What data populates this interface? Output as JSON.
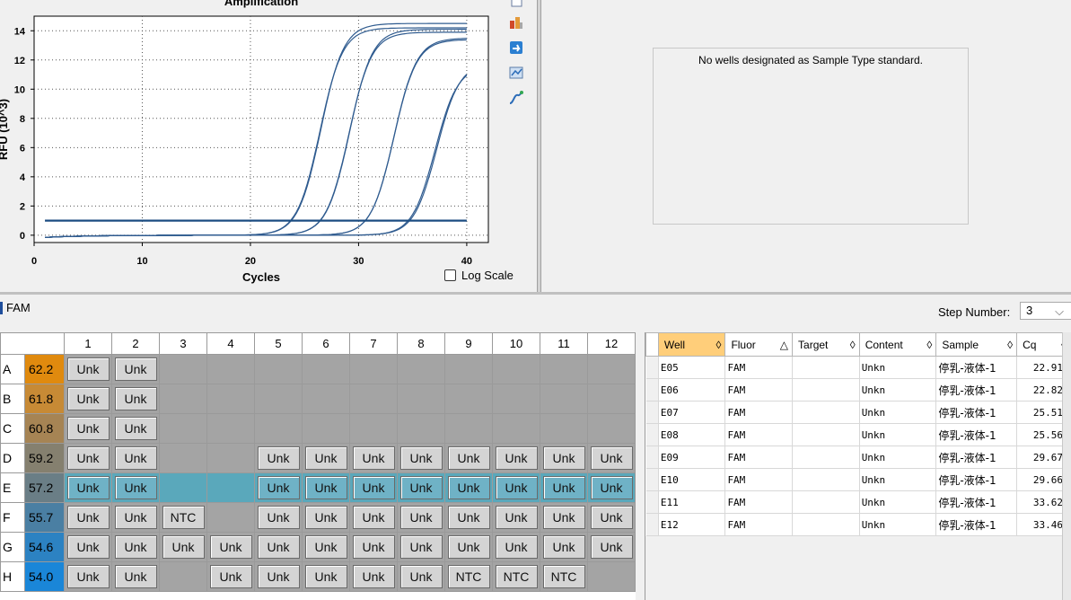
{
  "chart": {
    "title": "Amplification",
    "xlabel": "Cycles",
    "ylabel": "RFU (10^3)",
    "log_scale_label": "Log Scale"
  },
  "chart_data": {
    "type": "line",
    "title": "Amplification",
    "xlabel": "Cycles",
    "ylabel": "RFU (10^3)",
    "xlim": [
      0,
      42
    ],
    "ylim": [
      -0.5,
      15
    ],
    "x_ticks": [
      0,
      10,
      20,
      30,
      40
    ],
    "y_ticks": [
      0,
      2,
      4,
      6,
      8,
      10,
      12,
      14
    ],
    "threshold": 1.0,
    "grid": true,
    "series": [
      {
        "values_desc": "sigmoid",
        "cq": 22.91,
        "plateau": 14.5
      },
      {
        "values_desc": "sigmoid",
        "cq": 22.82,
        "plateau": 14.2
      },
      {
        "values_desc": "sigmoid",
        "cq": 25.51,
        "plateau": 13.9
      },
      {
        "values_desc": "sigmoid",
        "cq": 25.56,
        "plateau": 14.1
      },
      {
        "values_desc": "sigmoid",
        "cq": 29.67,
        "plateau": 13.5
      },
      {
        "values_desc": "sigmoid",
        "cq": 29.66,
        "plateau": 13.4
      },
      {
        "values_desc": "sigmoid",
        "cq": 33.62,
        "plateau": 11.8
      },
      {
        "values_desc": "sigmoid",
        "cq": 33.46,
        "plateau": 11.6
      }
    ],
    "color": "#2f5b8f"
  },
  "standard": {
    "message": "No wells designated as Sample Type standard."
  },
  "fluor": {
    "name": "FAM",
    "step_label": "Step Number:",
    "step_value": "3"
  },
  "plate": {
    "columns": [
      "1",
      "2",
      "3",
      "4",
      "5",
      "6",
      "7",
      "8",
      "9",
      "10",
      "11",
      "12"
    ],
    "rows": [
      {
        "label": "A",
        "temp": "62.2",
        "color": "#e08a0e",
        "wells": [
          "Unk",
          "Unk",
          "",
          "",
          "",
          "",
          "",
          "",
          "",
          "",
          "",
          ""
        ],
        "sel": false
      },
      {
        "label": "B",
        "temp": "61.8",
        "color": "#c78a35",
        "wells": [
          "Unk",
          "Unk",
          "",
          "",
          "",
          "",
          "",
          "",
          "",
          "",
          "",
          ""
        ],
        "sel": false
      },
      {
        "label": "C",
        "temp": "60.8",
        "color": "#a68454",
        "wells": [
          "Unk",
          "Unk",
          "",
          "",
          "",
          "",
          "",
          "",
          "",
          "",
          "",
          ""
        ],
        "sel": false
      },
      {
        "label": "D",
        "temp": "59.2",
        "color": "#85806f",
        "wells": [
          "Unk",
          "Unk",
          "",
          "",
          "Unk",
          "Unk",
          "Unk",
          "Unk",
          "Unk",
          "Unk",
          "Unk",
          "Unk"
        ],
        "sel": false
      },
      {
        "label": "E",
        "temp": "57.2",
        "color": "#6a7e86",
        "wells": [
          "Unk",
          "Unk",
          "",
          "",
          "Unk",
          "Unk",
          "Unk",
          "Unk",
          "Unk",
          "Unk",
          "Unk",
          "Unk"
        ],
        "sel": true
      },
      {
        "label": "F",
        "temp": "55.7",
        "color": "#4a7fa3",
        "wells": [
          "Unk",
          "Unk",
          "NTC",
          "",
          "Unk",
          "Unk",
          "Unk",
          "Unk",
          "Unk",
          "Unk",
          "Unk",
          "Unk"
        ],
        "sel": false
      },
      {
        "label": "G",
        "temp": "54.6",
        "color": "#2c82c2",
        "wells": [
          "Unk",
          "Unk",
          "Unk",
          "Unk",
          "Unk",
          "Unk",
          "Unk",
          "Unk",
          "Unk",
          "Unk",
          "Unk",
          "Unk"
        ],
        "sel": false
      },
      {
        "label": "H",
        "temp": "54.0",
        "color": "#1a86d8",
        "wells": [
          "Unk",
          "Unk",
          "",
          "Unk",
          "Unk",
          "Unk",
          "Unk",
          "Unk",
          "NTC",
          "NTC",
          "NTC",
          ""
        ],
        "sel": false
      }
    ]
  },
  "results": {
    "headers": [
      "Well",
      "Fluor",
      "Target",
      "Content",
      "Sample",
      "Cq"
    ],
    "sort_icons": [
      "◊",
      "△",
      "◊",
      "◊",
      "◊",
      "◊"
    ],
    "rows": [
      [
        "E05",
        "FAM",
        "",
        "Unkn",
        "停乳-液体-1",
        "22.91"
      ],
      [
        "E06",
        "FAM",
        "",
        "Unkn",
        "停乳-液体-1",
        "22.82"
      ],
      [
        "E07",
        "FAM",
        "",
        "Unkn",
        "停乳-液体-1",
        "25.51"
      ],
      [
        "E08",
        "FAM",
        "",
        "Unkn",
        "停乳-液体-1",
        "25.56"
      ],
      [
        "E09",
        "FAM",
        "",
        "Unkn",
        "停乳-液体-1",
        "29.67"
      ],
      [
        "E10",
        "FAM",
        "",
        "Unkn",
        "停乳-液体-1",
        "29.66"
      ],
      [
        "E11",
        "FAM",
        "",
        "Unkn",
        "停乳-液体-1",
        "33.62"
      ],
      [
        "E12",
        "FAM",
        "",
        "Unkn",
        "停乳-液体-1",
        "33.46"
      ]
    ]
  }
}
